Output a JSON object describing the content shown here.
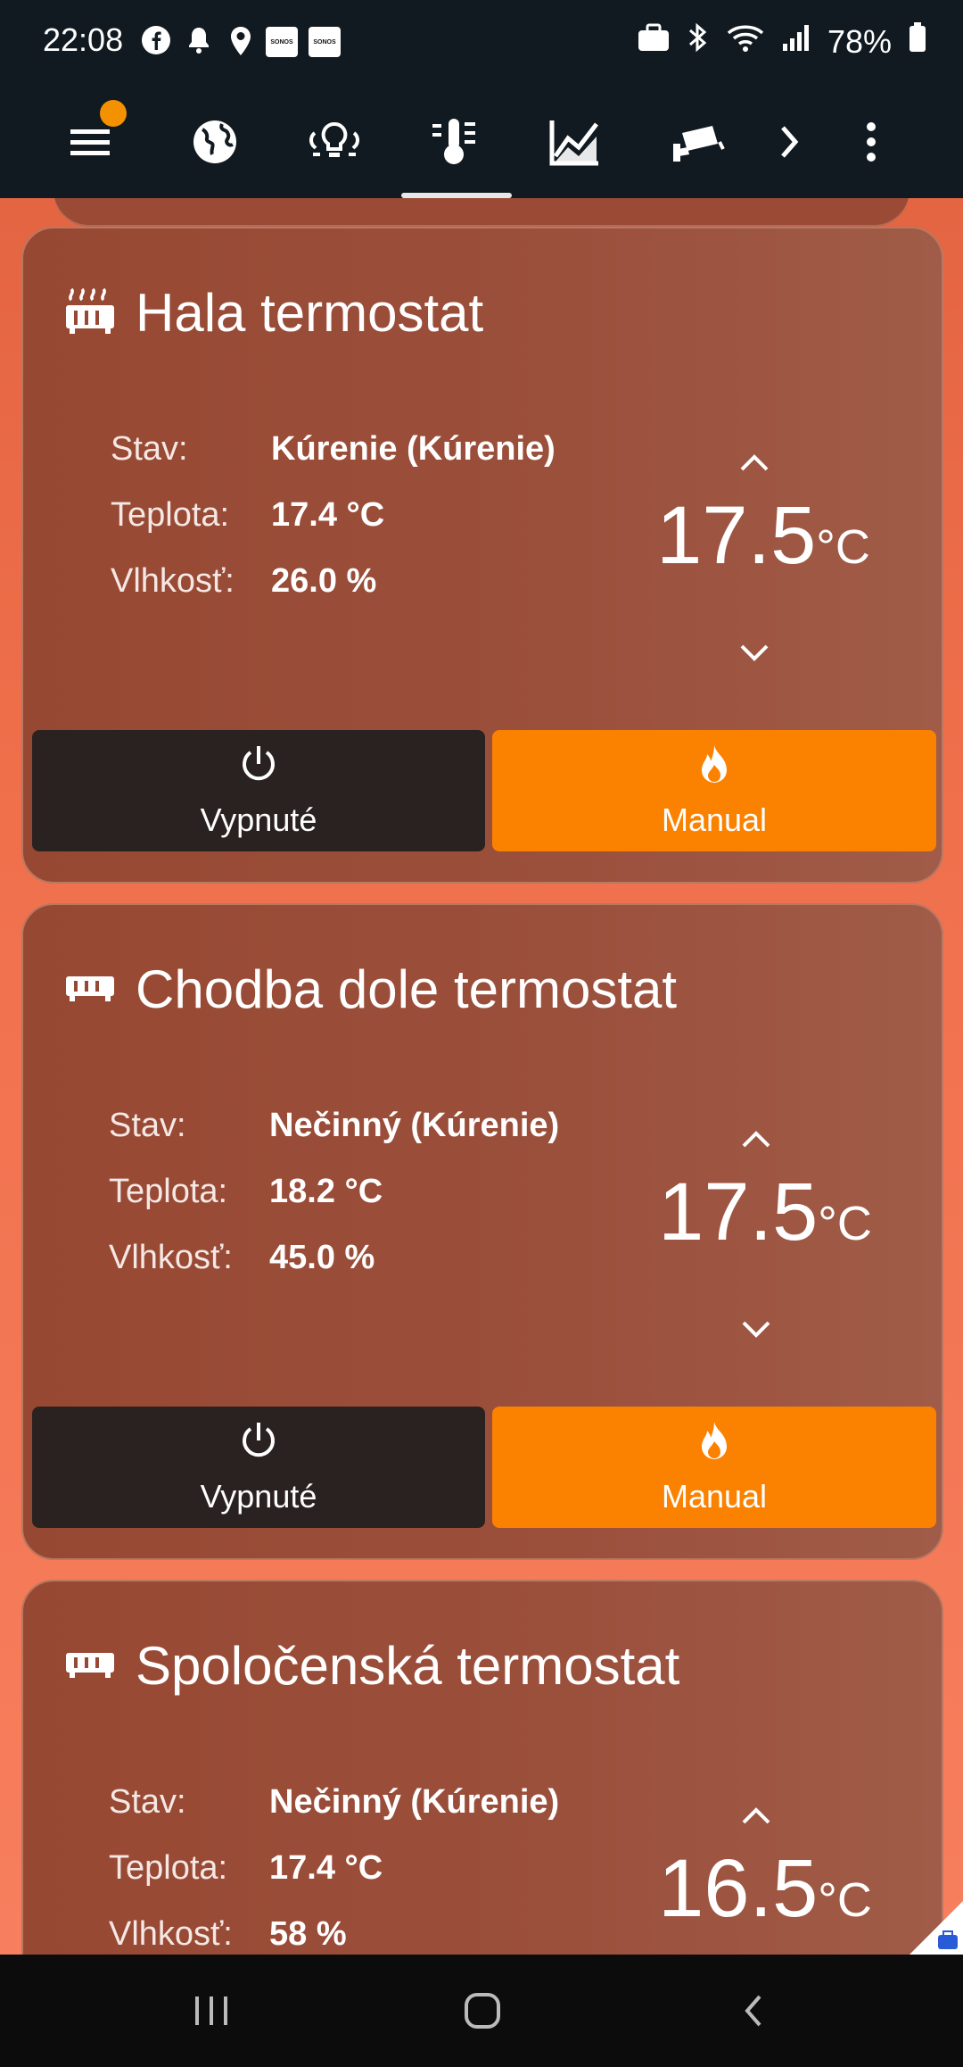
{
  "status": {
    "time": "22:08",
    "battery": "78%",
    "sonos1": "SONOS",
    "sonos2": "SONOS"
  },
  "toolbar": {
    "icons": [
      "menu-icon",
      "globe-icon",
      "lightbulb-group-icon",
      "thermostat-icon",
      "chart-icon",
      "camera-icon",
      "chevron-right-icon",
      "more-vert-icon"
    ],
    "active_tab": "thermostat"
  },
  "cards": [
    {
      "title": "Hala termostat",
      "state_label": "Stav:",
      "state_value": "Kúrenie (Kúrenie)",
      "temp_label": "Teplota:",
      "temp_value": "17.4 °C",
      "hum_label": "Vlhkosť:",
      "hum_value": "26.0 %",
      "setpoint": "17.5",
      "unit": "°C",
      "off_label": "Vypnuté",
      "manual_label": "Manual"
    },
    {
      "title": "Chodba dole termostat",
      "state_label": "Stav:",
      "state_value": "Nečinný (Kúrenie)",
      "temp_label": "Teplota:",
      "temp_value": "18.2 °C",
      "hum_label": "Vlhkosť:",
      "hum_value": "45.0 %",
      "setpoint": "17.5",
      "unit": "°C",
      "off_label": "Vypnuté",
      "manual_label": "Manual"
    },
    {
      "title": "Spoločenská termostat",
      "state_label": "Stav:",
      "state_value": "Nečinný (Kúrenie)",
      "temp_label": "Teplota:",
      "temp_value": "17.4 °C",
      "hum_label": "Vlhkosť:",
      "hum_value": "58 %",
      "setpoint": "16.5",
      "unit": "°C"
    }
  ],
  "colors": {
    "header": "#111a20",
    "accent": "#fb8200",
    "card": "#9b503c",
    "off_button": "#2a2220"
  }
}
